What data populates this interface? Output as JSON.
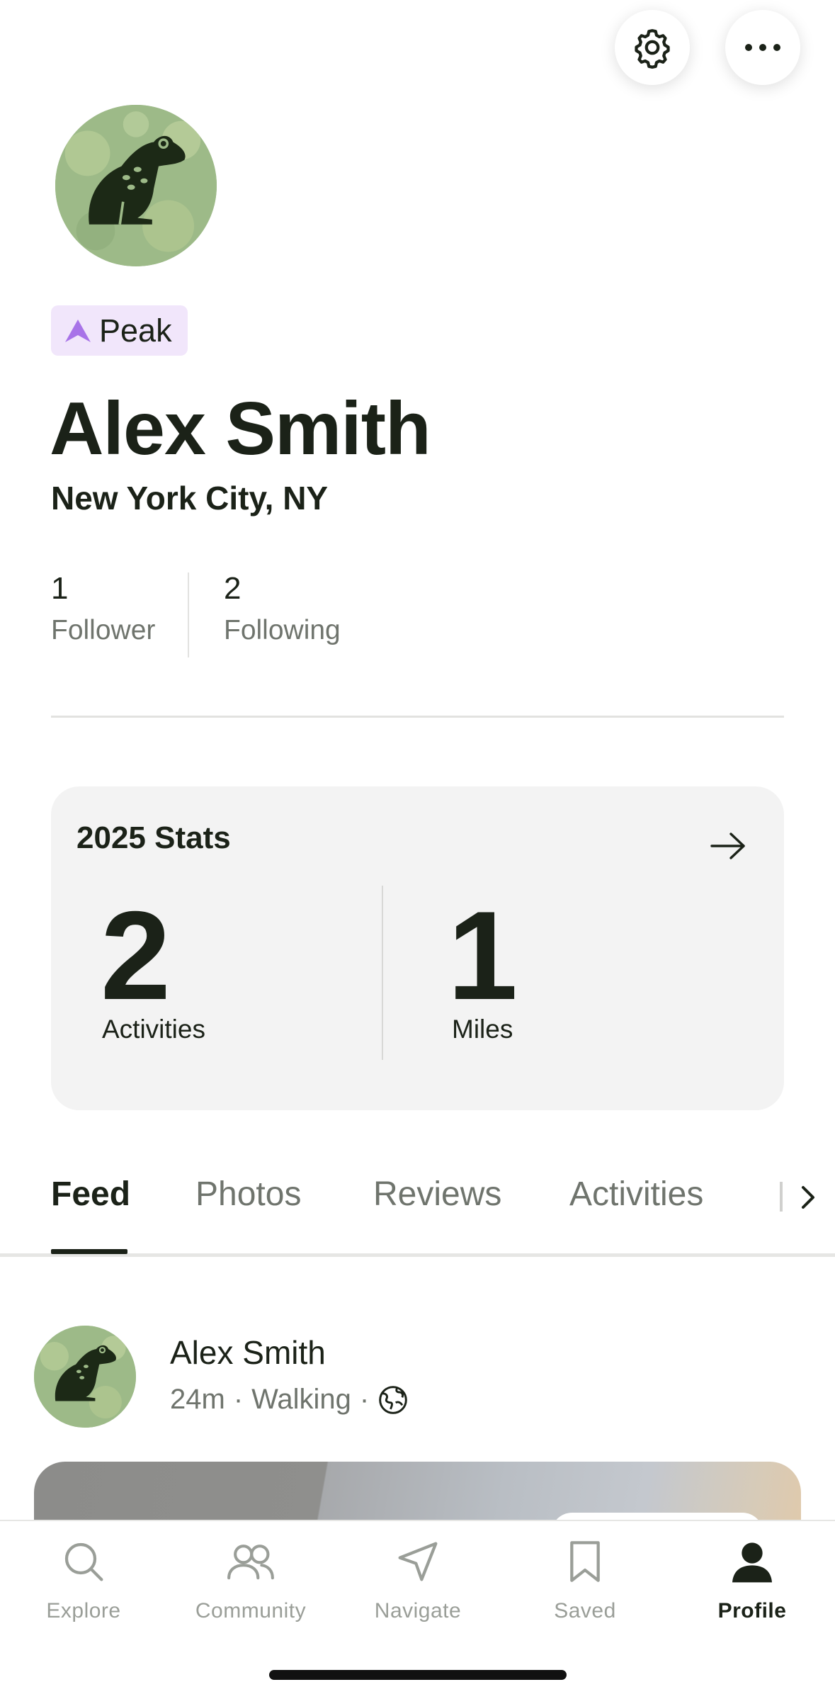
{
  "header": {
    "settings_icon": "gear-icon",
    "more_icon": "more-horizontal-icon"
  },
  "profile": {
    "badge": "Peak",
    "name": "Alex Smith",
    "location": "New York City, NY",
    "followers": {
      "count": "1",
      "label": "Follower"
    },
    "following": {
      "count": "2",
      "label": "Following"
    }
  },
  "stats": {
    "title": "2025 Stats",
    "activities": {
      "value": "2",
      "label": "Activities"
    },
    "miles": {
      "value": "1",
      "label": "Miles"
    }
  },
  "tabs": [
    {
      "label": "Feed",
      "active": true
    },
    {
      "label": "Photos"
    },
    {
      "label": "Reviews"
    },
    {
      "label": "Activities"
    }
  ],
  "feed": {
    "author": "Alex Smith",
    "time": "24m",
    "activity_type": "Walking",
    "separator": "·",
    "visibility_icon": "globe-icon"
  },
  "bottom_nav": [
    {
      "label": "Explore",
      "icon": "search-icon"
    },
    {
      "label": "Community",
      "icon": "community-icon"
    },
    {
      "label": "Navigate",
      "icon": "navigate-icon"
    },
    {
      "label": "Saved",
      "icon": "bookmark-icon"
    },
    {
      "label": "Profile",
      "icon": "profile-icon",
      "active": true
    }
  ],
  "colors": {
    "primary_text": "#1b2218",
    "secondary_text": "#6f746d",
    "badge_bg": "#f1e6fb",
    "badge_accent": "#a873e8",
    "card_bg": "#f3f3f3",
    "avatar_bg": "#9fbc8c"
  }
}
